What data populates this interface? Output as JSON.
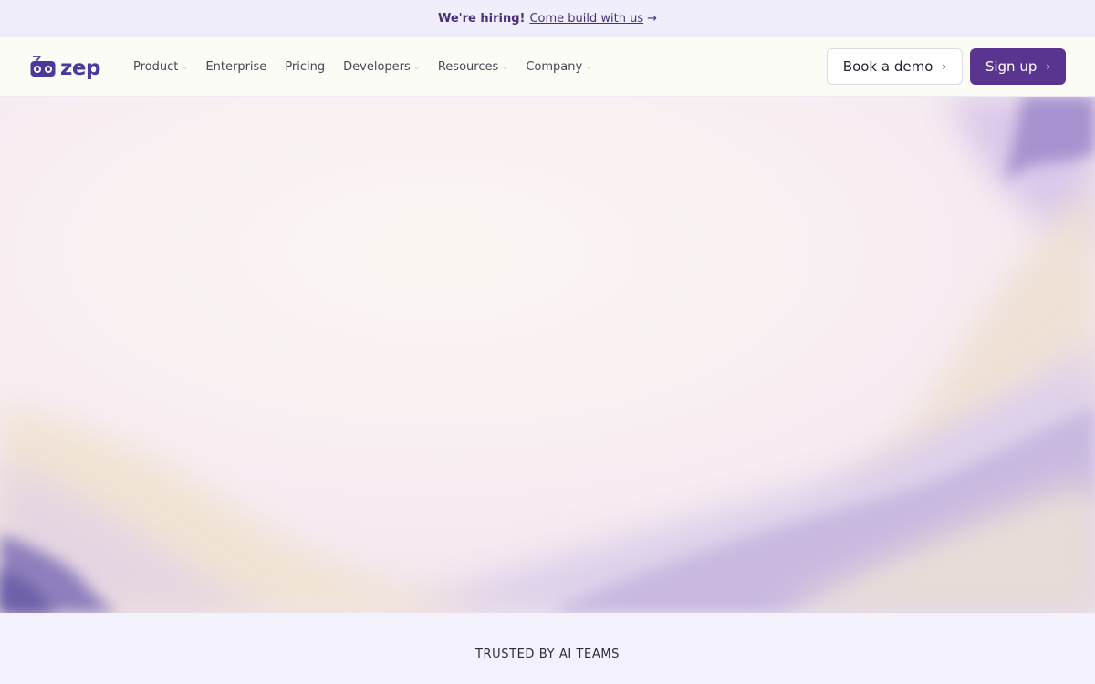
{
  "announcement": {
    "bold_text": "We're hiring!",
    "link_text": "Come build with us",
    "arrow": "→"
  },
  "logo": {
    "text": "zep",
    "icon": "robot-logo-icon",
    "color": "#4b3a9a"
  },
  "nav": {
    "items": [
      {
        "label": "Product",
        "has_dropdown": true
      },
      {
        "label": "Enterprise",
        "has_dropdown": false
      },
      {
        "label": "Pricing",
        "has_dropdown": false
      },
      {
        "label": "Developers",
        "has_dropdown": true
      },
      {
        "label": "Resources",
        "has_dropdown": true
      },
      {
        "label": "Company",
        "has_dropdown": true
      }
    ],
    "book_demo_label": "Book a demo",
    "sign_up_label": "Sign up",
    "chevron": "›",
    "caret": "⌵"
  },
  "colors": {
    "accent": "#5a3590",
    "announce_bg": "#f1eefb",
    "nav_bg": "#fbfcf6"
  },
  "trusted": {
    "label": "TRUSTED BY AI TEAMS"
  }
}
